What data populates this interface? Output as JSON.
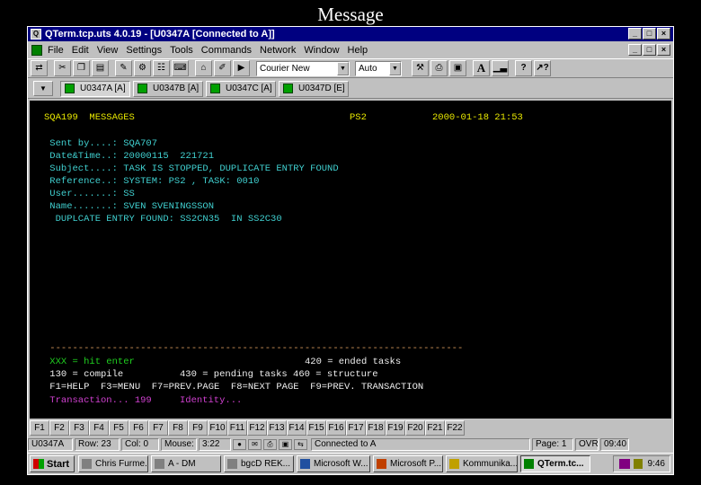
{
  "caption": "Message",
  "window": {
    "title": "QTerm.tcp.uts 4.0.19 - [U0347A [Connected to A]]",
    "controls": [
      "_",
      "□",
      "×"
    ]
  },
  "menu": [
    "File",
    "Edit",
    "View",
    "Settings",
    "Tools",
    "Commands",
    "Network",
    "Window",
    "Help"
  ],
  "toolbar": {
    "font_combo": "Courier New",
    "size_combo": "Auto"
  },
  "sessions": [
    {
      "label": "U0347A [A]",
      "active": true
    },
    {
      "label": "U0347B [A]",
      "active": false
    },
    {
      "label": "U0347C [A]",
      "active": false
    },
    {
      "label": "U0347D [E]",
      "active": false
    }
  ],
  "terminal": {
    "header_left": "SQA199  MESSAGES",
    "header_mid": "PS2",
    "header_right": "2000-01-18 21:53",
    "sent_by": " Sent by....: SQA707",
    "datetime": " Date&Time..: 20000115  221721",
    "subject": " Subject....: TASK IS STOPPED, DUPLICATE ENTRY FOUND",
    "reference": " Reference..: SYSTEM: PS2 , TASK: 0010",
    "user": " User.......: SS",
    "name": " Name.......: SVEN SVENINGSSON",
    "message": "  DUPLCATE ENTRY FOUND: SS2CN35  IN SS2C30",
    "separator": " -------------------------------------------------------------------------",
    "opt_xxx": " XXX = hit enter",
    "opt_420": "420 = ended tasks",
    "opt_130": " 130 = compile",
    "opt_430": "430 = pending tasks 460 = structure",
    "fkeys_line": " F1=HELP  F3=MENU  F7=PREV.PAGE  F8=NEXT PAGE  F9=PREV. TRANSACTION",
    "transaction_label": " Transaction... 199",
    "identity_label": "Identity..."
  },
  "function_keys": [
    "F1",
    "F2",
    "F3",
    "F4",
    "F5",
    "F6",
    "F7",
    "F8",
    "F9",
    "F10",
    "F11",
    "F12",
    "F13",
    "F14",
    "F15",
    "F16",
    "F17",
    "F18",
    "F19",
    "F20",
    "F21",
    "F22"
  ],
  "status": {
    "session": "U0347A",
    "row": "Row: 23",
    "col": "Col: 0",
    "mouse": "Mouse:",
    "mouse_pos": "3:22",
    "connection": "Connected to A",
    "page": "Page: 1",
    "ovr": "OVR",
    "time": "09:40"
  },
  "taskbar": {
    "start": "Start",
    "tasks": [
      {
        "label": "Chris Furme...",
        "active": false
      },
      {
        "label": "A - DM",
        "active": false
      },
      {
        "label": "bgcD REK...",
        "active": false
      },
      {
        "label": "Microsoft W...",
        "active": false
      },
      {
        "label": "Microsoft P...",
        "active": false
      },
      {
        "label": "Kommunika...",
        "active": false
      },
      {
        "label": "QTerm.tc...",
        "active": true
      }
    ],
    "clock": "9:46"
  }
}
